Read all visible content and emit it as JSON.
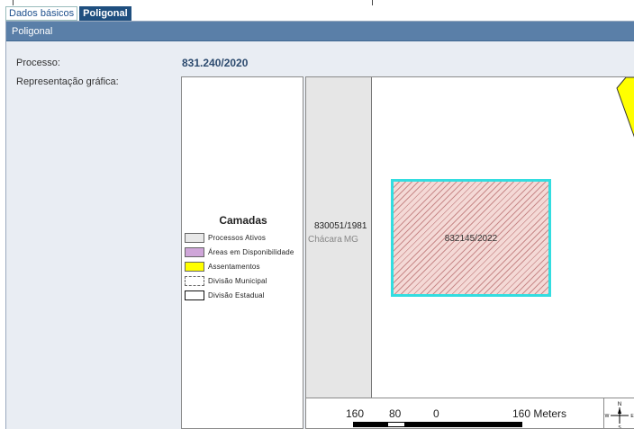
{
  "tabs": [
    {
      "label": "Dados básicos",
      "active": false
    },
    {
      "label": "Poligonal",
      "active": true
    }
  ],
  "panel": {
    "title": "Poligonal",
    "fields": {
      "processo_label": "Processo:",
      "processo_value": "831.240/2020",
      "representacao_label": "Representação gráfica:"
    }
  },
  "legend": {
    "title": "Camadas",
    "items": [
      {
        "label": "Processos Ativos",
        "color": "#e8e8e8",
        "style": "solid"
      },
      {
        "label": "Áreas em Disponibilidade",
        "color": "#cfa6d9",
        "style": "solid"
      },
      {
        "label": "Assentamentos",
        "color": "#ffff00",
        "style": "solid"
      },
      {
        "label": "Divisão Municipal",
        "color": "#ffffff",
        "style": "dashed"
      },
      {
        "label": "Divisão Estadual",
        "color": "#ffffff",
        "style": "solid-dark"
      }
    ]
  },
  "map": {
    "strip_label": "830051/1981",
    "locality_label": "Chácara",
    "state_label": "MG",
    "parcel_label": "832145/2022",
    "parcel_border_color": "#33dde0",
    "scale_labels": [
      "160",
      "80",
      "0",
      "160 Meters"
    ],
    "north_icon": "north-arrow-icon"
  }
}
